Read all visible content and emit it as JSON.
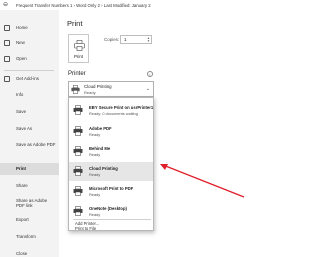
{
  "titlebar": {
    "path": "Frequent Transfer Numbers 1 › Word Only 2 › Last Modified: January 2"
  },
  "sidebar": {
    "items": [
      {
        "label": "Home",
        "icon": "home-icon"
      },
      {
        "label": "New",
        "icon": "new-document-icon"
      },
      {
        "label": "Open",
        "icon": "open-folder-icon"
      },
      {
        "label": "Get Add-ins",
        "icon": "add-ins-icon"
      },
      {
        "label": "Info"
      },
      {
        "label": "Save"
      },
      {
        "label": "Save As"
      },
      {
        "label": "Save as Adobe PDF"
      },
      {
        "label": "Print"
      },
      {
        "label": "Share"
      },
      {
        "label": "Share as Adobe PDF link"
      },
      {
        "label": "Export"
      },
      {
        "label": "Transform"
      },
      {
        "label": "Close"
      }
    ]
  },
  "main": {
    "title": "Print",
    "print_button_label": "Print",
    "copies_label": "Copies:",
    "copies_value": "1",
    "printer_heading": "Printer",
    "info_glyph": "i",
    "selected_printer": {
      "name": "Cloud Printing",
      "status": "Ready"
    },
    "chevron": "⌄"
  },
  "dropdown": {
    "printers": [
      {
        "name": "EBY Secure Print on usrPrinter1",
        "status": "Ready: 0 documents waiting",
        "icon": "printer-icon"
      },
      {
        "name": "Adobe PDF",
        "status": "Ready",
        "icon": "printer-icon"
      },
      {
        "name": "Behind Me",
        "status": "Ready",
        "icon": "printer-icon"
      },
      {
        "name": "Cloud Printing",
        "status": "Ready",
        "icon": "printer-icon"
      },
      {
        "name": "Microsoft Print to PDF",
        "status": "Ready",
        "icon": "printer-icon"
      },
      {
        "name": "OneNote (Desktop)",
        "status": "Ready",
        "icon": "printer-icon"
      }
    ],
    "add_printer": "Add Printer...",
    "print_to_file": "Print to File"
  },
  "colors": {
    "annotation_arrow": "#e0202a",
    "sidebar_bg": "#f3f3f3",
    "selected_row": "#e6e6e6"
  }
}
